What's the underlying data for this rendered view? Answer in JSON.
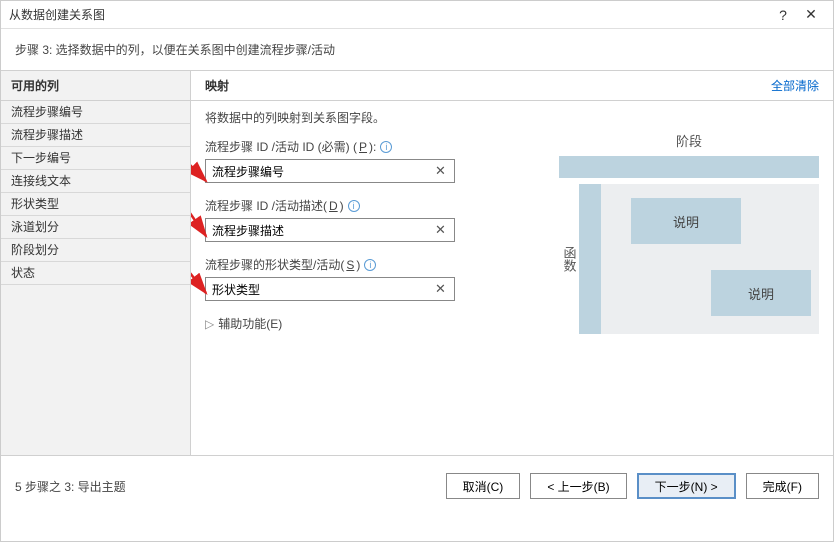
{
  "title": "从数据创建关系图",
  "subtitle": "步骤 3: 选择数据中的列，以便在关系图中创建流程步骤/活动",
  "left_header": "可用的列",
  "columns": [
    "流程步骤编号",
    "流程步骤描述",
    "下一步编号",
    "连接线文本",
    "形状类型",
    "泳道划分",
    "阶段划分",
    "状态"
  ],
  "right_header": "映射",
  "clear_all": "全部清除",
  "mapping_desc": "将数据中的列映射到关系图字段。",
  "field1_label": "流程步骤 ID /活动 ID (必需) (",
  "field1_accel": "P",
  "field1_suffix": "):",
  "field1_value": "流程步骤编号",
  "field2_label": "流程步骤 ID /活动描述(",
  "field2_accel": "D",
  "field2_suffix": ")",
  "field2_value": "流程步骤描述",
  "field3_label": "流程步骤的形状类型/活动(",
  "field3_accel": "S",
  "field3_suffix": ")",
  "field3_value": "形状类型",
  "aux_label": "辅助功能(",
  "aux_accel": "E",
  "aux_suffix": ")",
  "preview_phase": "阶段",
  "preview_swim": "函数",
  "preview_node1": "说明",
  "preview_node2": "说明",
  "step_text": "5 步骤之 3: 导出主题",
  "btn_cancel": "取消(C)",
  "btn_prev": "< 上一步(B)",
  "btn_next": "下一步(N) >",
  "btn_finish": "完成(F)"
}
